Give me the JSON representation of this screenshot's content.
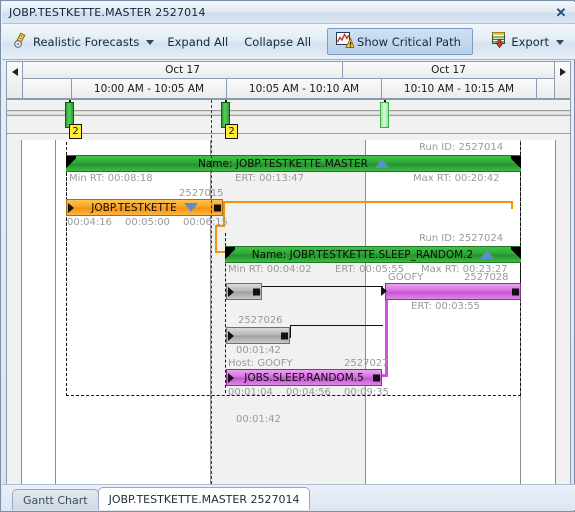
{
  "window": {
    "title": "JOBP.TESTKETTE.MASTER 2527014",
    "close_icon": "close-icon"
  },
  "toolbar": {
    "forecasts_label": "Realistic Forecasts",
    "forecasts_icon": "ruler-pencil-icon",
    "expand_all_label": "Expand All",
    "collapse_all_label": "Collapse All",
    "critical_path_label": "Show Critical Path",
    "critical_path_icon": "critical-path-warning-icon",
    "export_label": "Export",
    "export_icon": "export-icon"
  },
  "timeline": {
    "scroll_left_icon": "arrow-left-icon",
    "scroll_right_icon": "arrow-right-icon",
    "day_headers": [
      "Oct 17",
      "Oct 17"
    ],
    "interval_headers": [
      "10:00 AM - 10:05 AM",
      "10:05 AM - 10:10 AM",
      "10:10 AM - 10:15 AM",
      ""
    ]
  },
  "markers": [
    {
      "badge": "2",
      "style": "filled"
    },
    {
      "badge": "2",
      "style": "filled"
    },
    {
      "badge": "",
      "style": "outline"
    }
  ],
  "tasks": [
    {
      "id": "master",
      "run_id_label": "Run ID: 2527014",
      "name_label": "Name: JOBP.TESTKETTE.MASTER",
      "collapse_icon": "triangle-up-icon",
      "min_rt": "Min RT: 00:08:18",
      "ert": "ERT: 00:13:47",
      "max_rt": "Max RT: 00:20:42",
      "color": "#2fa437"
    },
    {
      "id": "testkette",
      "run_id_label": "2527015",
      "name_label": "JOBP.TESTKETTE",
      "expand_icon": "triangle-down-icon",
      "times": [
        "00:04:16",
        "00:05:00",
        "00:06:15"
      ],
      "color": "#fba21e"
    },
    {
      "id": "sleep_random_2",
      "run_id_label": "Run ID: 2527024",
      "name_label": "Name: JOBP.TESTKETTE.SLEEP_RANDOM.2",
      "collapse_icon": "triangle-up-icon",
      "min_rt": "Min RT: 00:04:02",
      "ert": "ERT: 00:05:55",
      "max_rt": "Max RT: 00:23:27",
      "color": "#2fa437"
    },
    {
      "id": "goofy_task",
      "host_label": "GOOFY",
      "run_id_label": "2527028",
      "ert": "ERT: 00:03:55",
      "color": "#d66fe0"
    },
    {
      "id": "gray_task_top",
      "color": "#b6b6b6"
    },
    {
      "id": "gray_task_bottom",
      "run_id_label": "2527026",
      "duration": "00:01:42",
      "color": "#b6b6b6"
    },
    {
      "id": "sleep_random_5",
      "host_label": "Host: GOOFY",
      "run_id_label": "2527027",
      "name_label": "JOBS.SLEEP.RANDOM.5",
      "times": [
        "00:01:04",
        "00:04:56",
        "00:09:35"
      ],
      "color": "#d66fe0"
    }
  ],
  "tabs": [
    {
      "label": "Gantt Chart",
      "active": false
    },
    {
      "label": "JOBP.TESTKETTE.MASTER 2527014",
      "active": true
    }
  ],
  "colors": {
    "accent": "#2fa437",
    "orange": "#fba21e",
    "purple": "#d66fe0",
    "gray": "#b6b6b6",
    "badge": "#ffec2e",
    "critical_path": "#1030e0"
  }
}
